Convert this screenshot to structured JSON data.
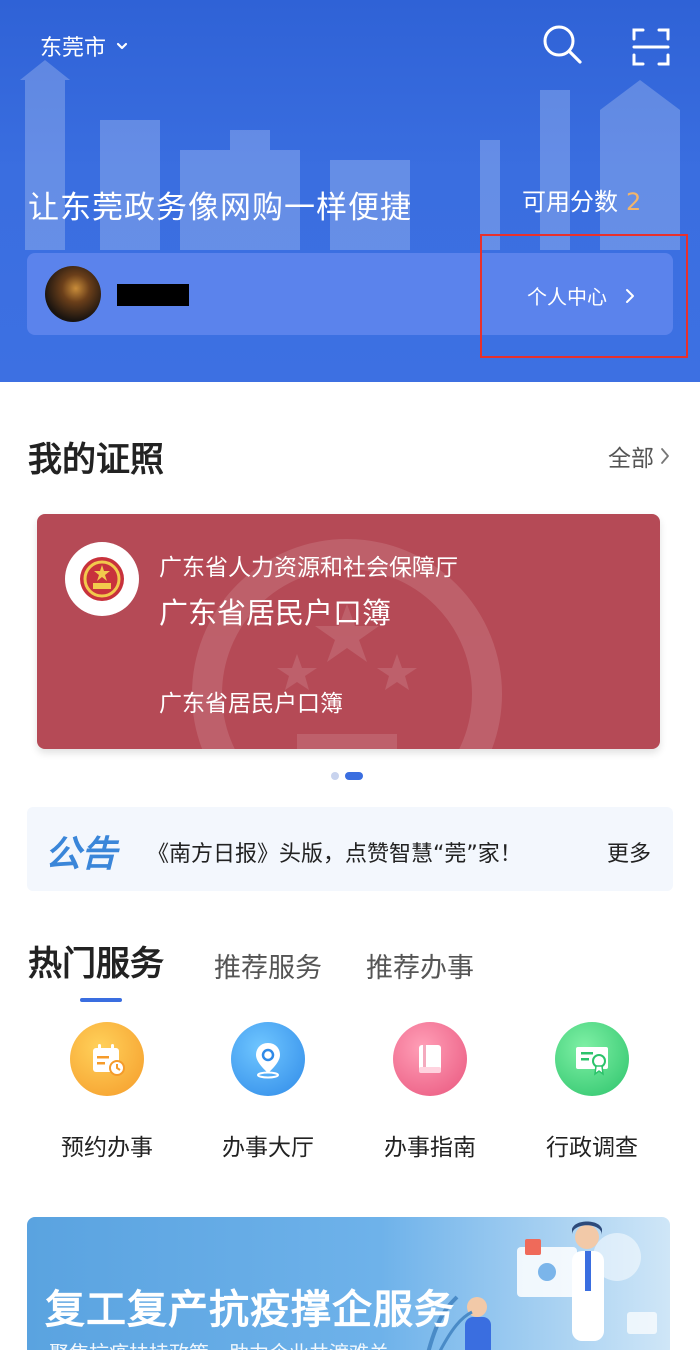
{
  "header": {
    "city": "东莞市",
    "slogan": "让东莞政务像网购一样便捷",
    "score_label": "可用分数",
    "score_value": "2",
    "personal_center": "个人中心"
  },
  "certificates": {
    "title": "我的证照",
    "all_label": "全部",
    "card": {
      "issuer": "广东省人力资源和社会保障厅",
      "name": "广东省居民户口簿",
      "subtitle": "广东省居民户口簿"
    },
    "carousel_page": 2,
    "carousel_total": 2
  },
  "notice": {
    "tag": "公告",
    "text": "《南方日报》头版，点赞智慧“莞”家！",
    "more": "更多"
  },
  "services": {
    "tabs": [
      "热门服务",
      "推荐服务",
      "推荐办事"
    ],
    "active_tab": 0,
    "items": [
      {
        "label": "预约办事",
        "icon": "calendar-icon"
      },
      {
        "label": "办事大厅",
        "icon": "location-pin-icon"
      },
      {
        "label": "办事指南",
        "icon": "book-icon"
      },
      {
        "label": "行政调查",
        "icon": "certificate-icon"
      }
    ]
  },
  "banner": {
    "title": "复工复产抗疫撑企服务",
    "subtitle": "聚焦抗疫扶持政策，助力企业共渡难关"
  },
  "colors": {
    "header_blue": "#3a6ee0",
    "cert_red": "#b54a56",
    "score_accent": "#f3b46a",
    "highlight_red": "#e8302c"
  }
}
